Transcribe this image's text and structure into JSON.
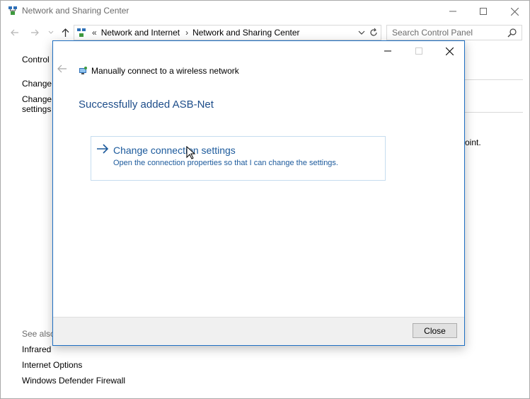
{
  "window": {
    "title": "Network and Sharing Center"
  },
  "address_bar": {
    "overflow": "«",
    "crumbs": [
      "Network and Internet",
      "Network and Sharing Center"
    ],
    "separator": "›"
  },
  "search": {
    "placeholder": "Search Control Panel"
  },
  "sidebar": {
    "items": [
      {
        "label": "Control P"
      },
      {
        "label": "Change a"
      },
      {
        "label": "Change a"
      },
      {
        "label": "settings"
      }
    ],
    "see_also_heading": "See also",
    "see_also": [
      {
        "label": "Infrared"
      },
      {
        "label": "Internet Options"
      },
      {
        "label": "Windows Defender Firewall"
      }
    ]
  },
  "background_fragments": {
    "point_text": "oint."
  },
  "dialog": {
    "title": "Manually connect to a wireless network",
    "success_message": "Successfully added ASB-Net",
    "option": {
      "title": "Change connection settings",
      "description": "Open the connection properties so that I can change the settings."
    },
    "close_label": "Close"
  },
  "icons": {
    "accent": "#1e6fc2",
    "link_color": "#1c5a9c",
    "heading_color": "#1d4d8a"
  }
}
